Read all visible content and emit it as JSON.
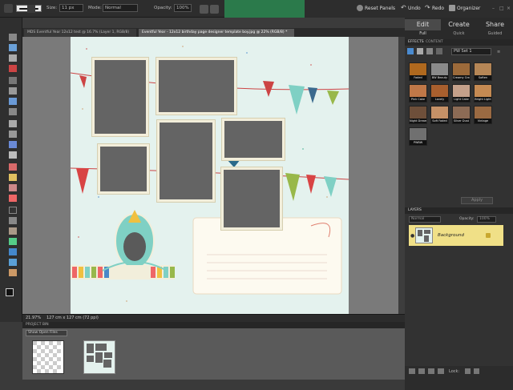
{
  "options_bar": {
    "size_label": "Size:",
    "size_value": "11 px",
    "mode_label": "Mode:",
    "mode_value": "Normal",
    "opacity_label": "Opacity:",
    "opacity_value": "100%"
  },
  "top_actions": {
    "reset_panels": "Reset Panels",
    "undo": "Undo",
    "redo": "Redo",
    "organizer": "Organizer"
  },
  "doc_tabs": [
    {
      "label": "MDS Eventful Year 12x12 test @ 16.7% (Layer 1, RGB/8)"
    },
    {
      "label": "Eventful Year - 12x12 birthday page designer template boy.jpg @ 22% (RGB/8) *"
    }
  ],
  "status": {
    "zoom": "21.97%",
    "dimensions": "127 cm x 127 cm (72 ppi)"
  },
  "project_bin": {
    "title": "PROJECT BIN",
    "filter": "Show Open Files"
  },
  "modes": {
    "edit": "Edit",
    "create": "Create",
    "share": "Share"
  },
  "edit_modes": {
    "full": "Full",
    "quick": "Quick",
    "guided": "Guided"
  },
  "effects_panel": {
    "tab_effects": "EFFECTS",
    "tab_content": "CONTENT",
    "set": "PW Set 1",
    "apply": "Apply",
    "items": [
      {
        "label": "Faded",
        "color": "#b0691e"
      },
      {
        "label": "BW Beauty",
        "color": "#8a8a8a"
      },
      {
        "label": "Creamy Cream",
        "color": "#9c6a3a"
      },
      {
        "label": "Soften",
        "color": "#b58656"
      },
      {
        "label": "Pink Cake",
        "color": "#c07848"
      },
      {
        "label": "Lovely",
        "color": "#a85f2e"
      },
      {
        "label": "Light Cake",
        "color": "#c4a08a"
      },
      {
        "label": "Bright Light",
        "color": "#c58a52"
      },
      {
        "label": "Night Dreams",
        "color": "#6e4f3a"
      },
      {
        "label": "Soft Faded",
        "color": "#c59167"
      },
      {
        "label": "Silver Dust",
        "color": "#8c6b55"
      },
      {
        "label": "Vintage",
        "color": "#9a6a42"
      },
      {
        "label": "PWBW",
        "color": "#707070"
      }
    ]
  },
  "layers_panel": {
    "title": "LAYERS",
    "blend": "Normal",
    "opacity_label": "Opacity:",
    "opacity_value": "100%",
    "layer_name": "Background",
    "lock_label": "Lock:"
  },
  "colors": {
    "accent_yellow": "#f0e087",
    "canvas_gray": "#7a7a7a",
    "page_mint": "#e4f2ee",
    "photo_gray": "#646464"
  }
}
